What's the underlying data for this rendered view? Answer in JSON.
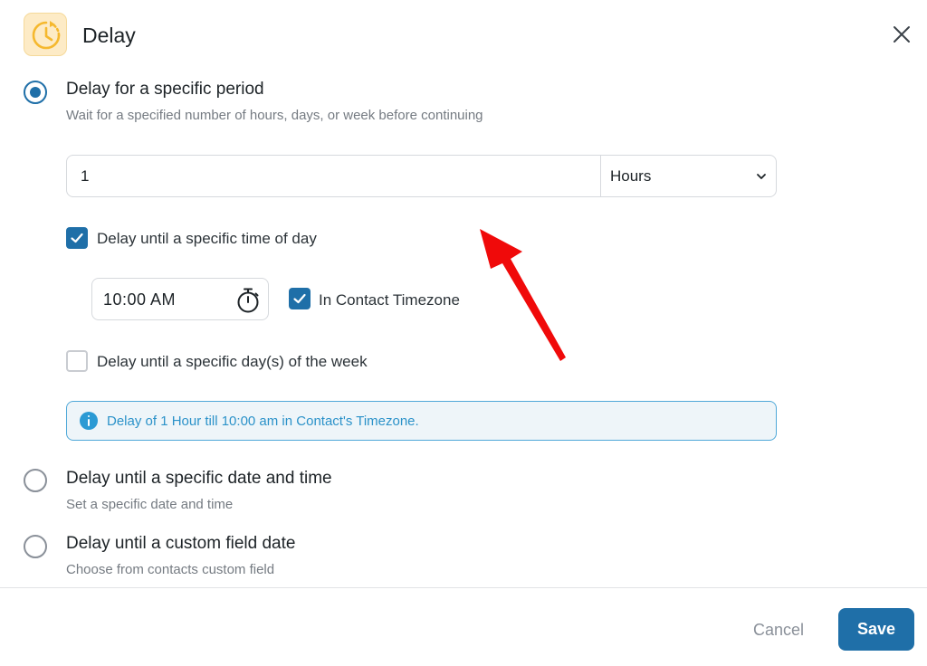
{
  "dialog": {
    "title": "Delay",
    "icon": "clock-icon",
    "close_icon": "close-icon"
  },
  "options": [
    {
      "title": "Delay for a specific period",
      "description": "Wait for a specified number of hours, days, or week before continuing",
      "selected": true
    },
    {
      "title": "Delay until a specific date and time",
      "description": "Set a specific date and time",
      "selected": false
    },
    {
      "title": "Delay until a custom field date",
      "description": "Choose from contacts custom field",
      "selected": false
    }
  ],
  "period": {
    "amount": "1",
    "unit": "Hours"
  },
  "time_of_day": {
    "label": "Delay until a specific time of day",
    "checked": true,
    "time": "10:00  AM",
    "timezone_label": "In Contact Timezone",
    "timezone_checked": true
  },
  "day_of_week": {
    "label": "Delay until a specific day(s) of the week",
    "checked": false
  },
  "info": {
    "text": "Delay of 1 Hour till 10:00 am in Contact's Timezone."
  },
  "footer": {
    "cancel_label": "Cancel",
    "save_label": "Save"
  },
  "colors": {
    "accent": "#1f6fa8",
    "info": "#2b92c9",
    "icon_bg": "#fdebc6",
    "icon_fg": "#f5b82e",
    "arrow": "#f00a0a"
  }
}
